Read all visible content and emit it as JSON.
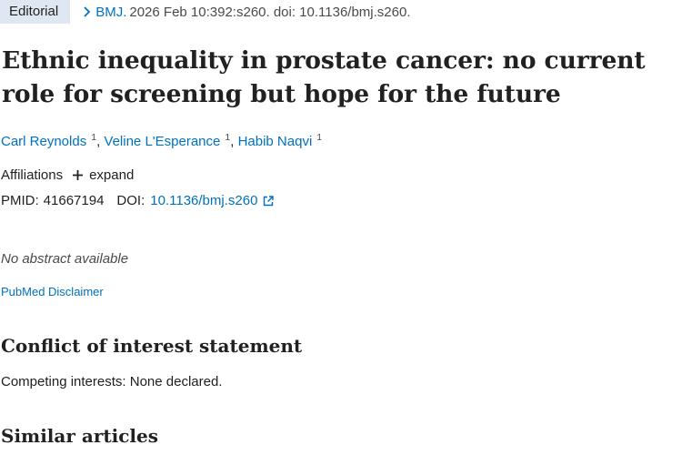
{
  "header": {
    "article_type": "Editorial",
    "journal": "BMJ.",
    "citation": "2026 Feb 10:392:s260. doi: 10.1136/bmj.s260."
  },
  "article": {
    "title": "Ethnic inequality in prostate cancer: no current role for screening but hope for the future",
    "authors": [
      {
        "name": "Carl Reynolds",
        "aff": "1"
      },
      {
        "name": "Veline L'Esperance",
        "aff": "1"
      },
      {
        "name": "Habib Naqvi",
        "aff": "1"
      }
    ],
    "author_separator": ",",
    "affiliations_label": "Affiliations",
    "expand_label": "expand",
    "pmid_label": "PMID:",
    "pmid": "41667194",
    "doi_label": "DOI:",
    "doi": "10.1136/bmj.s260",
    "no_abstract": "No abstract available",
    "disclaimer": "PubMed Disclaimer"
  },
  "sections": {
    "coi_heading": "Conflict of interest statement",
    "coi_text": "Competing interests: None declared.",
    "similar_heading": "Similar articles"
  },
  "icons": {
    "chevron": "chevron-right-icon",
    "plus": "plus-icon",
    "external": "external-link-icon"
  },
  "colors": {
    "link": "#0071bc",
    "badge_bg": "#dfe8f2",
    "text": "#212121"
  }
}
